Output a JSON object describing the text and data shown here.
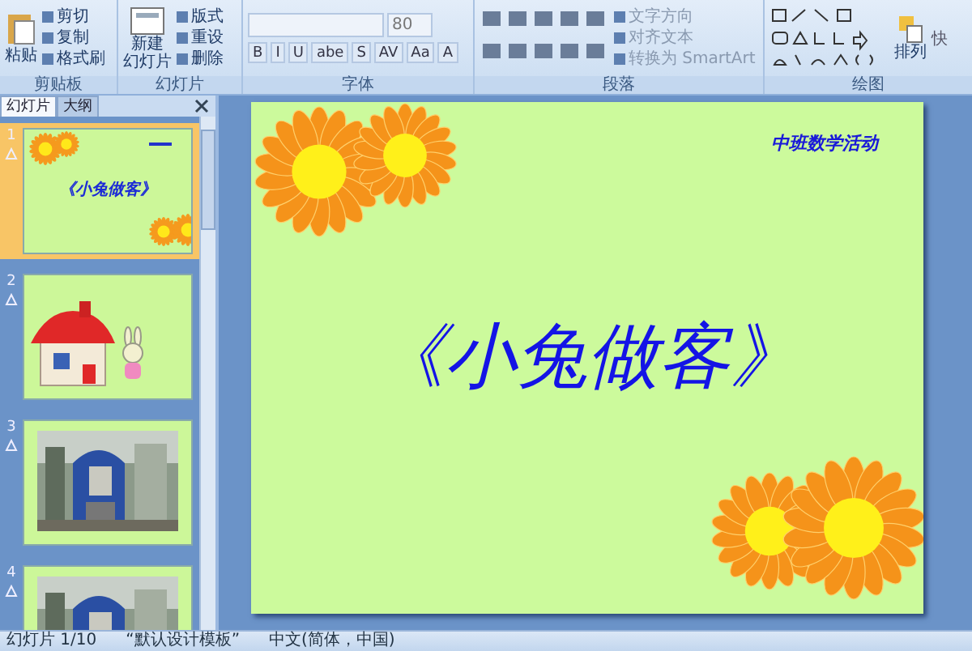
{
  "ribbon": {
    "clipboard": {
      "label": "剪贴板",
      "paste": "粘贴",
      "commands": [
        "剪切",
        "复制",
        "格式刷"
      ]
    },
    "slides": {
      "label": "幻灯片",
      "new_slide": [
        "新建",
        "幻灯片"
      ],
      "commands": [
        "版式",
        "重设",
        "删除"
      ]
    },
    "font": {
      "label": "字体",
      "size": "80",
      "buttons": [
        "B",
        "I",
        "U",
        "abe",
        "S",
        "AV",
        "Aa",
        "A"
      ]
    },
    "paragraph": {
      "label": "段落",
      "commands": [
        "文字方向",
        "对齐文本",
        "转换为 SmartArt"
      ]
    },
    "drawing": {
      "label": "绘图",
      "arrange": "排列",
      "quick": "快"
    }
  },
  "panel": {
    "tabs": [
      {
        "label": "幻灯片",
        "selected": true
      },
      {
        "label": "大纲",
        "selected": false
      }
    ],
    "slides": [
      {
        "number": "1",
        "kind": "title",
        "selected": true,
        "title": "《小兔做客》"
      },
      {
        "number": "2",
        "kind": "house",
        "selected": false
      },
      {
        "number": "3",
        "selected": false
      },
      {
        "number": "4",
        "selected": false
      }
    ]
  },
  "slide": {
    "subtitle": "中班数学活动",
    "title": "《小兔做客》"
  },
  "status_bar": [
    "幻灯片 1/10",
    "“默认设计模板”",
    "中文(简体，中国)"
  ]
}
